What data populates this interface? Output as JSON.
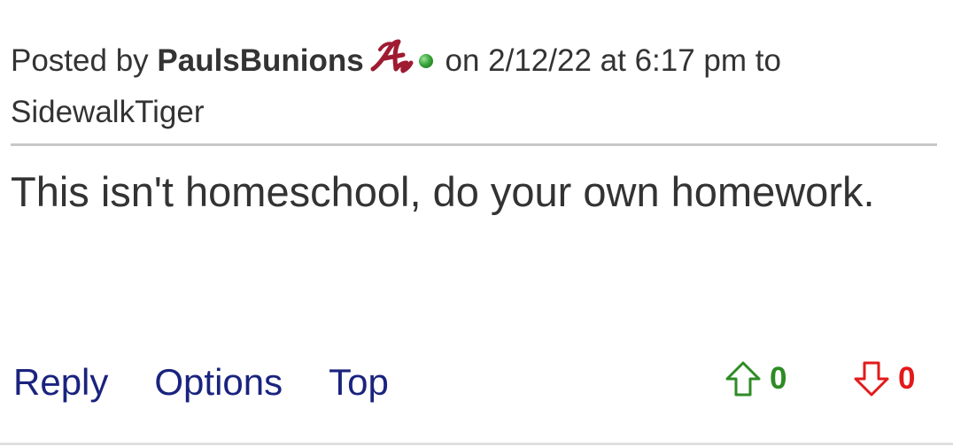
{
  "post": {
    "posted_by_prefix": "Posted by",
    "username": "PaulsBunions",
    "team_logo": "alabama-script-a-logo",
    "online_status": "online",
    "timestamp_text": "on 2/12/22 at 6:17 pm to",
    "reply_to": "SidewalkTiger",
    "body": "This isn't homeschool, do your own homework."
  },
  "actions": {
    "reply_label": "Reply",
    "options_label": "Options",
    "top_label": "Top"
  },
  "votes": {
    "up_count": "0",
    "down_count": "0",
    "up_color": "#2e8b24",
    "down_color": "#e21a1a"
  },
  "colors": {
    "link": "#1a237e",
    "text": "#333333",
    "logo": "#9e1b32"
  }
}
